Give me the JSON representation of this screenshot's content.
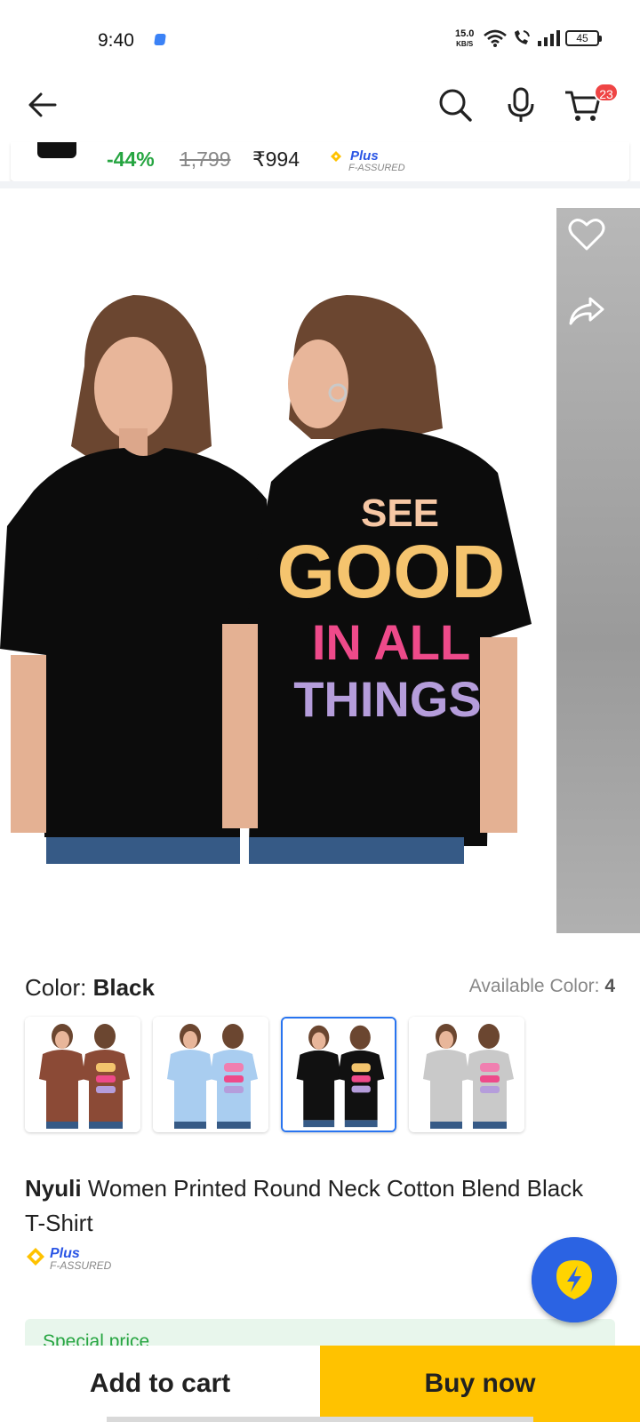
{
  "status_bar": {
    "time": "9:40",
    "net_speed_value": "15.0",
    "net_speed_unit": "KB/S",
    "battery": "45"
  },
  "app_bar": {
    "cart_count": "23",
    "icons": [
      "back-arrow-icon",
      "search-icon",
      "mic-icon",
      "cart-icon"
    ]
  },
  "mini_strip": {
    "discount": "-44%",
    "mrp": "1,799",
    "price": "₹994",
    "plus_label": "Plus",
    "assured_label": "F-ASSURED"
  },
  "gallery": {
    "shirt_print_lines": [
      "SEE",
      "GOOD",
      "IN ALL",
      "THINGS"
    ],
    "icons": [
      "heart-icon",
      "share-icon"
    ]
  },
  "color": {
    "label": "Color:",
    "selected": "Black",
    "available_label": "Available Color:",
    "available_count": "4",
    "swatches": [
      {
        "name": "brown",
        "shirt": "#8b4a36",
        "print": "#f3c46d"
      },
      {
        "name": "sky-blue",
        "shirt": "#a9cdf0",
        "print": "#f07fb0"
      },
      {
        "name": "black",
        "shirt": "#111111",
        "print": "#f3c46d",
        "selected": true
      },
      {
        "name": "grey",
        "shirt": "#c9c9c9",
        "print": "#f07fb0"
      }
    ]
  },
  "product": {
    "brand": "Nyuli",
    "title": "Women Printed Round Neck Cotton Blend Black T-Shirt",
    "plus_label": "Plus",
    "assured_label": "F-ASSURED"
  },
  "offer": {
    "special_price": "Special price"
  },
  "actions": {
    "add_to_cart": "Add to cart",
    "buy_now": "Buy now"
  },
  "colors": {
    "accent": "#2874f0",
    "buy_now_bg": "#ffc200",
    "discount_green": "#26a541",
    "badge_red": "#ef4444"
  }
}
